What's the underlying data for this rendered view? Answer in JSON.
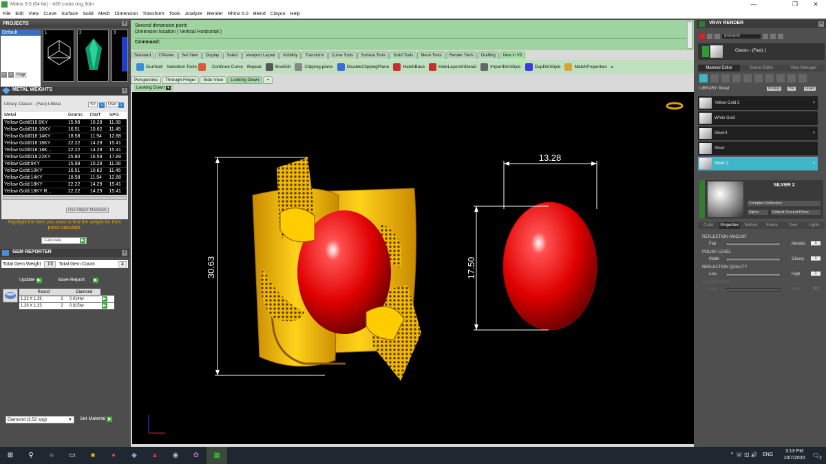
{
  "window": {
    "title": "Matrix 9.0 (64-bit) - 430 croba ring.3dm",
    "minimize": "—",
    "maximize": "❐",
    "close": "✕"
  },
  "menu": [
    "File",
    "Edit",
    "View",
    "Curve",
    "Surface",
    "Solid",
    "Mesh",
    "Dimension",
    "Transform",
    "Tools",
    "Analyze",
    "Render",
    "Rhino 5.0",
    "Blend",
    "Clayoo",
    "Help"
  ],
  "projects": {
    "title": "PROJECTS",
    "item": "Default",
    "hinge": "Hngr",
    "thumbs": [
      "1",
      "2",
      "3"
    ]
  },
  "metal_weights": {
    "title": "METAL WEIGHTS",
    "library": "Library: Classic - (Fast) I-Metal",
    "sv": "SV",
    "user": "User",
    "columns": [
      "Metal",
      "Grams",
      "DWT",
      "SPG"
    ],
    "rows": [
      [
        "Yellow Gold018:9KY",
        "15.98",
        "10.28",
        "11.08"
      ],
      [
        "Yellow Gold018:10KY",
        "16.51",
        "10.62",
        "11.45"
      ],
      [
        "Yellow Gold018:14KY",
        "18.58",
        "11.94",
        "12.88"
      ],
      [
        "Yellow Gold018:18KY",
        "22.22",
        "14.29",
        "15.41"
      ],
      [
        "Yellow Gold018:18K...",
        "22.22",
        "14.29",
        "15.41"
      ],
      [
        "Yellow Gold018:22KY",
        "25.80",
        "16.59",
        "17.89"
      ],
      [
        "Yellow Gold:9KY",
        "15.98",
        "10.28",
        "11.08"
      ],
      [
        "Yellow Gold:10KY",
        "16.51",
        "10.62",
        "11.45"
      ],
      [
        "Yellow Gold:14KY",
        "18.58",
        "11.94",
        "12.88"
      ],
      [
        "Yellow Gold:18KY",
        "22.22",
        "14.29",
        "15.41"
      ],
      [
        "Yellow Gold:18KY R...",
        "22.22",
        "14.29",
        "15.41"
      ]
    ],
    "use_object_materials": "Use Object Materials",
    "hint": "Highlight the item you want to find the weight for then press calculate.",
    "calculate": "Calculate"
  },
  "gem_reporter": {
    "title": "GEM REPORTER",
    "total_weight_label": "Total Gem Weight",
    "total_weight": ".03",
    "total_count_label": "Total Gem Count",
    "total_count": "4",
    "update": "Update",
    "save_report": "Save Report",
    "columns": [
      "Round",
      "Diamond"
    ],
    "rows": [
      [
        "1.22 X 1.26",
        "2",
        "0.014tw"
      ],
      [
        "1.26 X 1.23",
        "2",
        "0.015tw"
      ]
    ],
    "gem_select": "Diamond     (3.52 spg)",
    "set_material": "Set Material"
  },
  "command": {
    "line1": "Second dimension point:",
    "line2": "Dimension location ( Vertical  Horizontal )",
    "label": "Command:"
  },
  "toolbar_tabs": [
    "Standard",
    "CPlanes",
    "Set View",
    "Display",
    "Select",
    "Viewport Layout",
    "Visibility",
    "Transform",
    "Curve Tools",
    "Surface Tools",
    "Solid Tools",
    "Mesh Tools",
    "Render Tools",
    "Drafting",
    "New in V5"
  ],
  "toolbar": [
    {
      "label": "Gumball",
      "color": "#3b8ed6"
    },
    {
      "label": "Selection Tools",
      "color": "#d65a3b"
    },
    {
      "label": "Continue Curve",
      "color": "#555555"
    },
    {
      "label": "Repeat",
      "color": "#888888"
    },
    {
      "label": "BoxEdit",
      "color": "#3b6bd6"
    },
    {
      "label": "Clipping plane",
      "color": "#c83030"
    },
    {
      "label": "DisableClippingPlane",
      "color": "#c83030"
    },
    {
      "label": "HatchBase",
      "color": "#666666"
    },
    {
      "label": "HideLayersInDetail",
      "color": "#3b3bd6"
    },
    {
      "label": "ImportDimStyle",
      "color": "#d6a33b"
    },
    {
      "label": "DupDimStyle",
      "color": "#4a4a4a"
    },
    {
      "label": "MatchProperties",
      "color": "#6a6a6a"
    }
  ],
  "toolbar_more": "»",
  "viewport_tabs": [
    "Perspective",
    "Through Finger",
    "Side View",
    "Looking Down"
  ],
  "viewport_add": "+",
  "active_viewport": "Looking Down",
  "dimensions": {
    "top": "13.28",
    "left": "30.63",
    "right": "17.50"
  },
  "vray": {
    "title": "VRAY RENDER",
    "resolution": "800x600",
    "style": "Classic - (Fast) 1",
    "tabs": [
      "Material Editor",
      "Scene Editor",
      "View Manager"
    ],
    "library": "LIBRARY: Metal",
    "group": "Group",
    "sv": "SV",
    "user": "User",
    "materials": [
      "Yellow Gold 2",
      "White Gold",
      "Silver4",
      "Silver",
      "Silver 2"
    ],
    "selected_material": "SILVER 2",
    "reflection": "Complex Reflection",
    "alpha": "Alpha",
    "ground": "Default Ground Plane",
    "prop_tabs": [
      "Color",
      "Properties",
      "Texture",
      "Scene",
      "Toon",
      "Lights"
    ],
    "reflection_amount": {
      "label": "REFLECTION AMOUNT",
      "min": "Flat",
      "max": "Metallic",
      "value": "1"
    },
    "polish_level": {
      "label": "POLISH LEVEL",
      "min": "Matte",
      "max": "Glossy",
      "value": "1"
    },
    "reflection_quality": {
      "label": "REFLECTION QUALITY",
      "min": "Low",
      "max": "High",
      "value": "1"
    },
    "ab_label": "ABSORPTION",
    "ab_min": "Low",
    "ab_max": "High",
    "ab_value": "0"
  },
  "taskbar": {
    "lang": "ENG",
    "time": "3:13 PM",
    "date": "10/7/2020",
    "notify": "2"
  },
  "colors": {
    "green_panel": "#9fd4a0",
    "gold": "#f2c200",
    "gem": "#e00000",
    "accent": "#3fb7c8"
  }
}
